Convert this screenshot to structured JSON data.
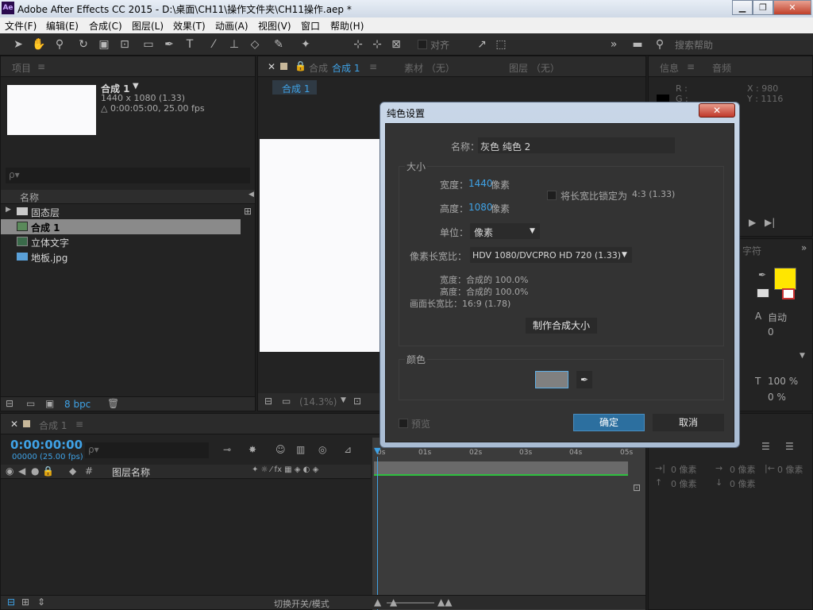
{
  "window": {
    "title": "Adobe After Effects CC 2015 - D:\\桌面\\CH11\\操作文件夹\\CH11操作.aep *",
    "app_icon": "Ae",
    "minimize": "▁",
    "maximize": "❐",
    "close": "✕"
  },
  "menu": [
    "文件(F)",
    "编辑(E)",
    "合成(C)",
    "图层(L)",
    "效果(T)",
    "动画(A)",
    "视图(V)",
    "窗口",
    "帮助(H)"
  ],
  "toolbar": {
    "align_label": "对齐",
    "search_placeholder": "搜索帮助"
  },
  "project_panel": {
    "tab": "项目",
    "comp_name": "合成 1",
    "comp_dims": "1440 x 1080 (1.33)",
    "comp_duration": "△ 0:00:05:00, 25.00 fps",
    "search_placeholder": "ρ▾",
    "column_name": "名称",
    "items": [
      {
        "name": "固态层",
        "type": "folder"
      },
      {
        "name": "合成 1",
        "type": "comp"
      },
      {
        "name": "立体文字",
        "type": "comp"
      },
      {
        "name": "地板.jpg",
        "type": "image"
      }
    ],
    "bpc": "8 bpc"
  },
  "comp_panel": {
    "tab_prefix": "合成",
    "tab_name": "合成 1",
    "footage_tab": "素材 （无）",
    "layer_tab": "图层 （无）",
    "breadcrumb": "合成 1",
    "zoom": "(14.3%)"
  },
  "info_panel": {
    "tab": "信息",
    "audio_tab": "音频",
    "r_label": "R :",
    "g_label": "G :",
    "x_value": "X : 980",
    "y_value": "Y : 1116"
  },
  "right_panel": {
    "tab": "字符",
    "auto": "自动",
    "zero": "0",
    "percent1": "100 %",
    "percent2": "0 %",
    "fill_color": "#ffe600",
    "px_labels": [
      "0 像素",
      "0 像素",
      "0 像素",
      "0 像素",
      "0 像素"
    ]
  },
  "timeline": {
    "tab": "合成 1",
    "timecode": "0:00:00:00",
    "frames": "00000 (25.00 fps)",
    "search_placeholder": "ρ▾",
    "layer_name_col": "图层名称",
    "hash_col": "#",
    "ruler": [
      "0s",
      "01s",
      "02s",
      "03s",
      "04s",
      "05s"
    ],
    "bottom_label": "切换开关/模式"
  },
  "dialog": {
    "title": "纯色设置",
    "close": "✕",
    "name_label": "名称：",
    "name_value": "灰色 纯色 2",
    "size_group": "大小",
    "width_label": "宽度：",
    "width_value": "1440",
    "height_label": "高度：",
    "height_value": "1080",
    "px_unit": "像素",
    "lock_label": "将长宽比锁定为",
    "lock_ratio": "4:3 (1.33)",
    "units_label": "单位：",
    "units_value": "像素",
    "par_label": "像素长宽比：",
    "par_value": "HDV 1080/DVCPRO HD 720 (1.33)",
    "width_pct": "宽度：合成的 100.0%",
    "height_pct": "高度：合成的 100.0%",
    "frame_ratio": "画面长宽比：16:9 (1.78)",
    "make_comp_size": "制作合成大小",
    "color_group": "颜色",
    "swatch_color": "#808080",
    "preview_label": "预览",
    "ok": "确定",
    "cancel": "取消"
  }
}
